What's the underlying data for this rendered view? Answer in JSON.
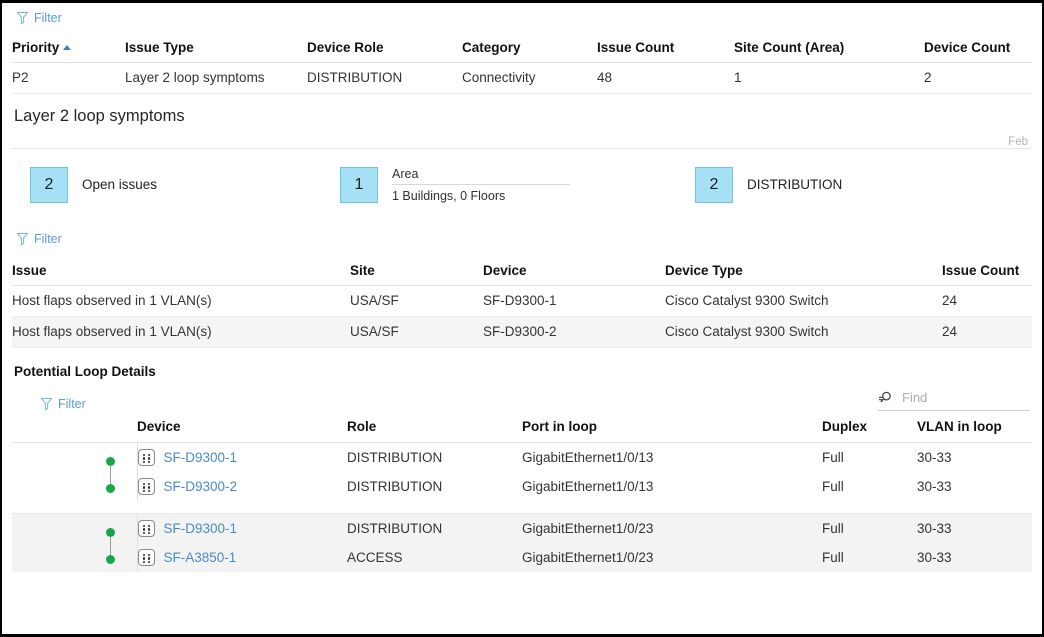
{
  "icons": {
    "filter": "filter-funnel-icon",
    "find": "search-magnifier-icon",
    "device": "network-device-icon",
    "sort_asc": "sort-ascending-caret-icon"
  },
  "colors": {
    "link": "#4a89c8",
    "priority_p2": "#e8b33c",
    "badge_fill": "#a6e0f5",
    "badge_border": "#6fc4e4",
    "status_dot": "#14a84b",
    "row_alt": "#f5f5f5"
  },
  "top_toolbar": {
    "filter_label": "Filter"
  },
  "issue_type_table": {
    "columns": [
      "Priority",
      "Issue Type",
      "Device Role",
      "Category",
      "Issue Count",
      "Site Count (Area)",
      "Device Count"
    ],
    "rows": [
      {
        "priority": "P2",
        "issue_type": "Layer 2 loop symptoms",
        "device_role": "DISTRIBUTION",
        "category": "Connectivity",
        "issue_count": "48",
        "site_count": "1",
        "device_count": "2"
      }
    ]
  },
  "detail": {
    "title": "Layer 2 loop symptoms",
    "month_label": "Feb"
  },
  "summary": [
    {
      "count": "2",
      "label": "Open issues"
    },
    {
      "count": "1",
      "label": "Area",
      "sublabel": "1 Buildings, 0 Floors"
    },
    {
      "count": "2",
      "label": "DISTRIBUTION"
    }
  ],
  "issues_toolbar": {
    "filter_label": "Filter"
  },
  "issues_table": {
    "columns": [
      "Issue",
      "Site",
      "Device",
      "Device Type",
      "Issue Count"
    ],
    "rows": [
      {
        "issue": "Host flaps observed in 1 VLAN(s)",
        "site": "USA/SF",
        "device": "SF-D9300-1",
        "device_type": "Cisco Catalyst 9300 Switch",
        "issue_count": "24"
      },
      {
        "issue": "Host flaps observed in 1 VLAN(s)",
        "site": "USA/SF",
        "device": "SF-D9300-2",
        "device_type": "Cisco Catalyst 9300 Switch",
        "issue_count": "24"
      }
    ]
  },
  "loop_section": {
    "title": "Potential Loop Details",
    "filter_label": "Filter",
    "find_placeholder": "Find",
    "find_value": "",
    "columns": [
      "Device",
      "Role",
      "Port in loop",
      "Duplex",
      "VLAN in loop"
    ],
    "groups": [
      {
        "rows": [
          {
            "device": "SF-D9300-1",
            "role": "DISTRIBUTION",
            "port": "GigabitEthernet1/0/13",
            "duplex": "Full",
            "vlan": "30-33"
          },
          {
            "device": "SF-D9300-2",
            "role": "DISTRIBUTION",
            "port": "GigabitEthernet1/0/13",
            "duplex": "Full",
            "vlan": "30-33"
          }
        ]
      },
      {
        "rows": [
          {
            "device": "SF-D9300-1",
            "role": "DISTRIBUTION",
            "port": "GigabitEthernet1/0/23",
            "duplex": "Full",
            "vlan": "30-33"
          },
          {
            "device": "SF-A3850-1",
            "role": "ACCESS",
            "port": "GigabitEthernet1/0/23",
            "duplex": "Full",
            "vlan": "30-33"
          }
        ]
      }
    ]
  }
}
